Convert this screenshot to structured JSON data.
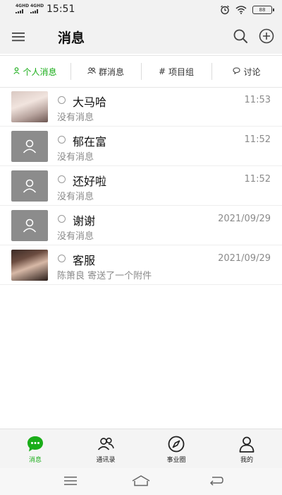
{
  "status_bar": {
    "sig1": "4GHD",
    "sig2": "4GHD",
    "time": "15:51",
    "battery": "88"
  },
  "header": {
    "title": "消息"
  },
  "tabs": [
    {
      "label": "个人消息",
      "icon": "person-icon",
      "active": true
    },
    {
      "label": "群消息",
      "icon": "group-icon",
      "active": false
    },
    {
      "label": "项目组",
      "icon": "hash-icon",
      "active": false
    },
    {
      "label": "讨论",
      "icon": "chat-bubble-icon",
      "active": false
    }
  ],
  "conversations": [
    {
      "name": "大马哈",
      "preview": "没有消息",
      "time": "11:53",
      "avatar": "photo"
    },
    {
      "name": "郁在富",
      "preview": "没有消息",
      "time": "11:52",
      "avatar": "default-user-icon"
    },
    {
      "name": "还好啦",
      "preview": "没有消息",
      "time": "11:52",
      "avatar": "default-user-icon"
    },
    {
      "name": "谢谢",
      "preview": "没有消息",
      "time": "2021/09/29",
      "avatar": "default-user-icon"
    },
    {
      "name": "客服",
      "preview": "陈箫良 寄送了一个附件",
      "time": "2021/09/29",
      "avatar": "photo"
    }
  ],
  "bottom_nav": [
    {
      "label": "消息",
      "icon": "message-icon",
      "active": true
    },
    {
      "label": "通讯录",
      "icon": "contacts-icon",
      "active": false
    },
    {
      "label": "事业圈",
      "icon": "compass-icon",
      "active": false
    },
    {
      "label": "我的",
      "icon": "profile-icon",
      "active": false
    }
  ],
  "colors": {
    "accent": "#1aad19",
    "header_bg": "#f2f2f2",
    "secondary_text": "#8a8a8a"
  }
}
